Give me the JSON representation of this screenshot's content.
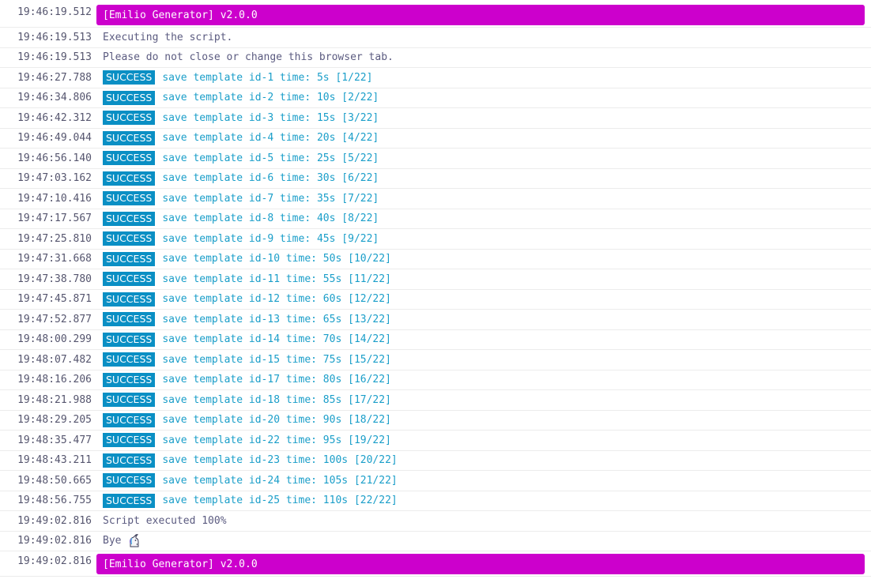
{
  "colors": {
    "banner_bg": "#cc00cc",
    "badge_bg": "#0a8fc4",
    "success_text": "#1a9ec9",
    "plain_text": "#5b5b80"
  },
  "header": {
    "timestamp": "19:46:19.512",
    "text": "[Emilio Generator] v2.0.0"
  },
  "intro": [
    {
      "timestamp": "19:46:19.513",
      "text": "Executing the script."
    },
    {
      "timestamp": "19:46:19.513",
      "text": "Please do not close or change this browser tab."
    }
  ],
  "badge_label": "SUCCESS",
  "entries": [
    {
      "timestamp": "19:46:27.788",
      "text": "save template id-1 time: 5s [1/22]"
    },
    {
      "timestamp": "19:46:34.806",
      "text": "save template id-2 time: 10s [2/22]"
    },
    {
      "timestamp": "19:46:42.312",
      "text": "save template id-3 time: 15s [3/22]"
    },
    {
      "timestamp": "19:46:49.044",
      "text": "save template id-4 time: 20s [4/22]"
    },
    {
      "timestamp": "19:46:56.140",
      "text": "save template id-5 time: 25s [5/22]"
    },
    {
      "timestamp": "19:47:03.162",
      "text": "save template id-6 time: 30s [6/22]"
    },
    {
      "timestamp": "19:47:10.416",
      "text": "save template id-7 time: 35s [7/22]"
    },
    {
      "timestamp": "19:47:17.567",
      "text": "save template id-8 time: 40s [8/22]"
    },
    {
      "timestamp": "19:47:25.810",
      "text": "save template id-9 time: 45s [9/22]"
    },
    {
      "timestamp": "19:47:31.668",
      "text": "save template id-10 time: 50s [10/22]"
    },
    {
      "timestamp": "19:47:38.780",
      "text": "save template id-11 time: 55s [11/22]"
    },
    {
      "timestamp": "19:47:45.871",
      "text": "save template id-12 time: 60s [12/22]"
    },
    {
      "timestamp": "19:47:52.877",
      "text": "save template id-13 time: 65s [13/22]"
    },
    {
      "timestamp": "19:48:00.299",
      "text": "save template id-14 time: 70s [14/22]"
    },
    {
      "timestamp": "19:48:07.482",
      "text": "save template id-15 time: 75s [15/22]"
    },
    {
      "timestamp": "19:48:16.206",
      "text": "save template id-17 time: 80s [16/22]"
    },
    {
      "timestamp": "19:48:21.988",
      "text": "save template id-18 time: 85s [17/22]"
    },
    {
      "timestamp": "19:48:29.205",
      "text": "save template id-20 time: 90s [18/22]"
    },
    {
      "timestamp": "19:48:35.477",
      "text": "save template id-22 time: 95s [19/22]"
    },
    {
      "timestamp": "19:48:43.211",
      "text": "save template id-23 time: 100s [20/22]"
    },
    {
      "timestamp": "19:48:50.665",
      "text": "save template id-24 time: 105s [21/22]"
    },
    {
      "timestamp": "19:48:56.755",
      "text": "save template id-25 time: 110s [22/22]"
    }
  ],
  "outro": [
    {
      "timestamp": "19:49:02.816",
      "text": "Script executed 100%"
    },
    {
      "timestamp": "19:49:02.816",
      "text": "Bye",
      "icon": "unicorn-icon"
    }
  ],
  "footer": {
    "timestamp": "19:49:02.816",
    "text": "[Emilio Generator] v2.0.0"
  }
}
